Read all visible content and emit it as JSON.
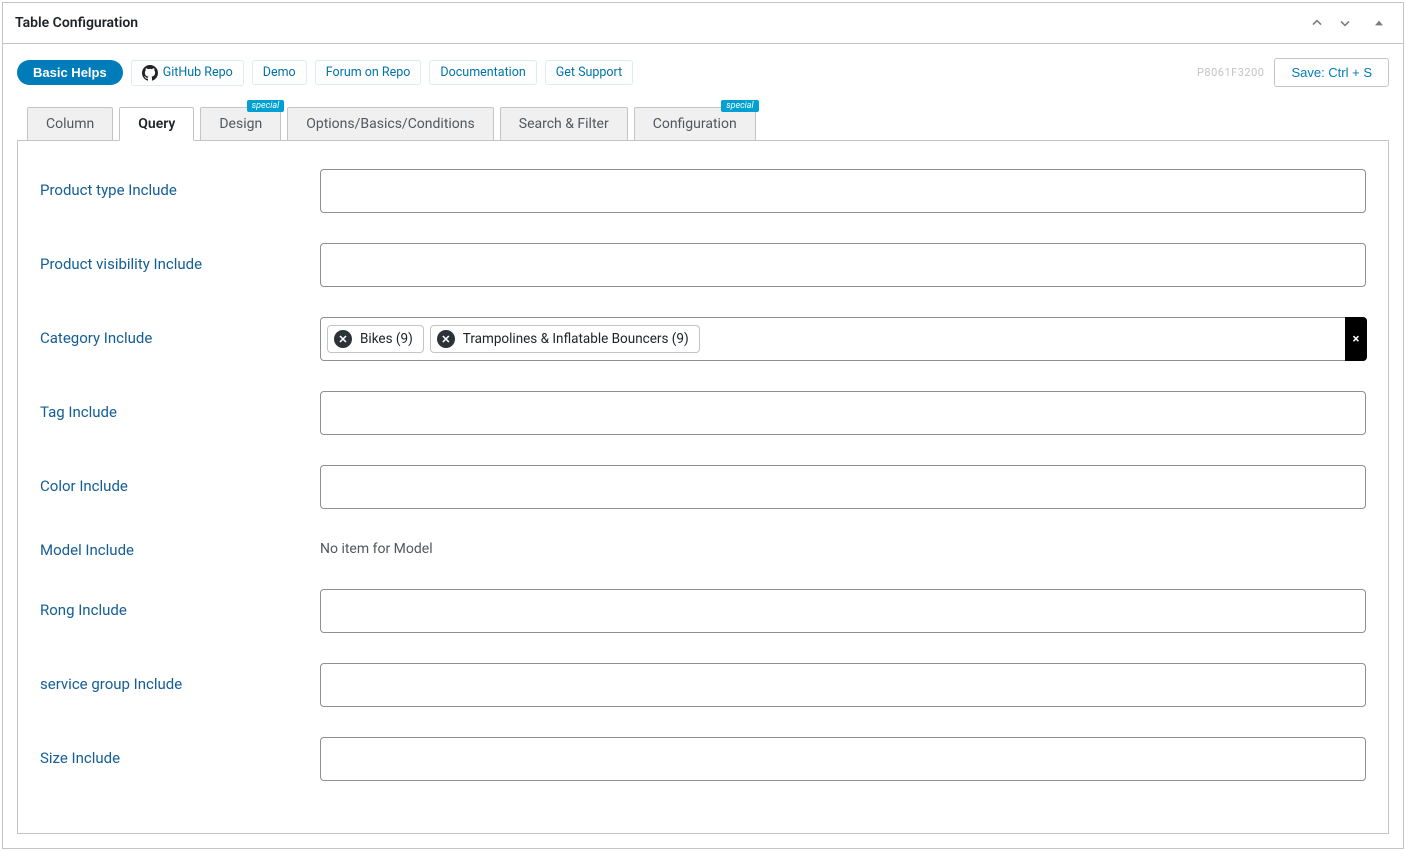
{
  "header": {
    "title": "Table Configuration"
  },
  "toolbar": {
    "basic_helps": "Basic Helps",
    "github_repo": "GitHub Repo",
    "demo": "Demo",
    "forum": "Forum on Repo",
    "documentation": "Documentation",
    "get_support": "Get Support",
    "hash": "P8061F3200",
    "save": "Save: Ctrl + S"
  },
  "tabs": {
    "column": "Column",
    "query": "Query",
    "design": "Design",
    "options": "Options/Basics/Conditions",
    "search": "Search & Filter",
    "config": "Configuration",
    "badge": "special"
  },
  "form": {
    "product_type": {
      "label": "Product type Include"
    },
    "product_visibility": {
      "label": "Product visibility Include"
    },
    "category": {
      "label": "Category Include",
      "chips": [
        {
          "label": "Bikes (9)"
        },
        {
          "label": "Trampolines & Inflatable Bouncers (9)"
        }
      ]
    },
    "tag": {
      "label": "Tag Include"
    },
    "color": {
      "label": "Color Include"
    },
    "model": {
      "label": "Model Include",
      "empty_text": "No item for Model"
    },
    "rong": {
      "label": "Rong Include"
    },
    "service_group": {
      "label": "service group Include"
    },
    "size": {
      "label": "Size Include"
    }
  },
  "glyphs": {
    "x": "✕",
    "clear": "×"
  }
}
